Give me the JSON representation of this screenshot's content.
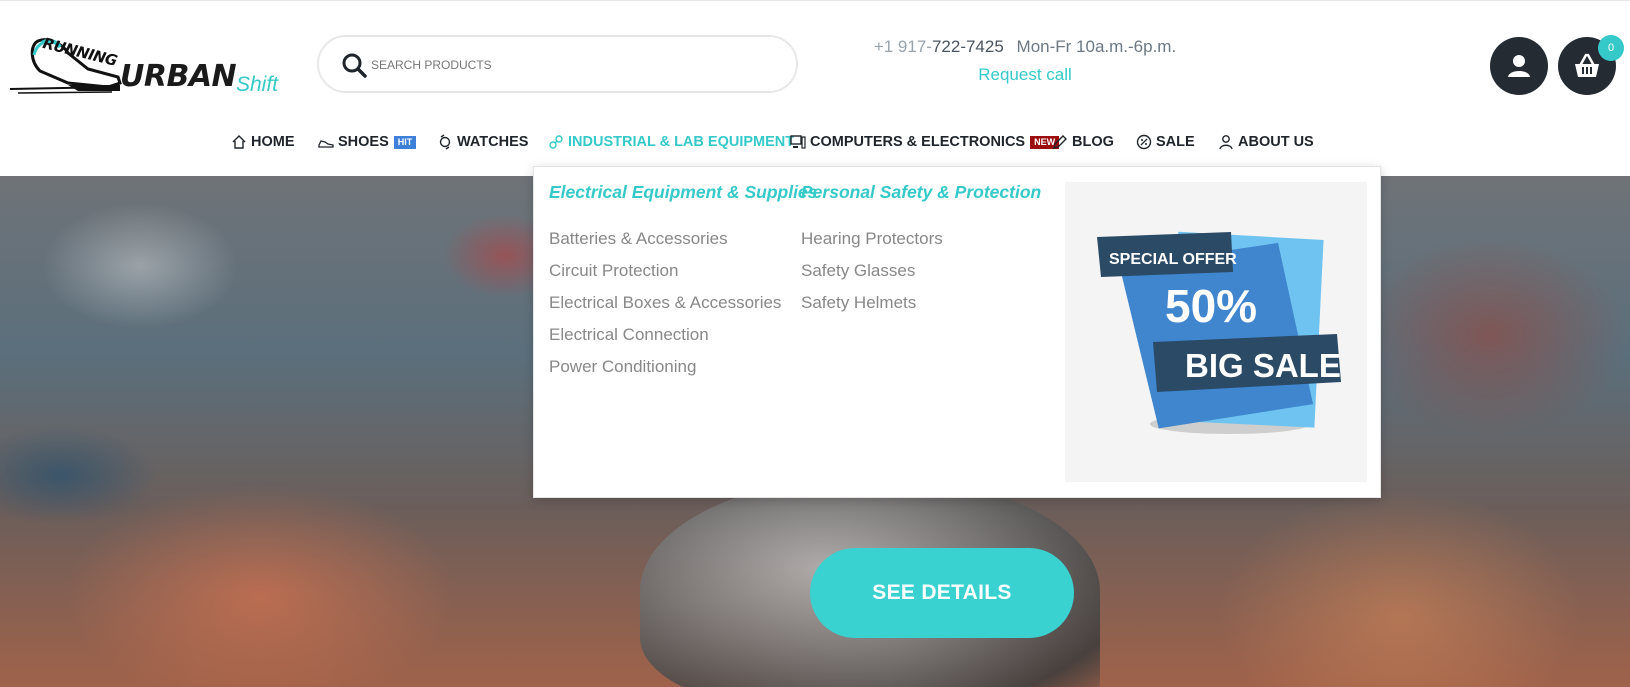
{
  "brand": {
    "running": "RUNNING",
    "urban": "URBAN",
    "shift": "Shift"
  },
  "search": {
    "placeholder": "SEARCH PRODUCTS"
  },
  "contact": {
    "phone_prefix": "+1 917-",
    "phone_main": "722-7425",
    "hours": "Mon-Fr 10a.m.-6p.m.",
    "request_call": "Request call"
  },
  "cart": {
    "count": "0"
  },
  "nav": {
    "items": [
      {
        "label": "HOME",
        "icon": "home-icon"
      },
      {
        "label": "SHOES",
        "icon": "shoe-icon",
        "badge": "HIT"
      },
      {
        "label": "WATCHES",
        "icon": "watch-icon"
      },
      {
        "label": "INDUSTRIAL & LAB EQUIPMENT",
        "icon": "link-icon",
        "active": true
      },
      {
        "label": "COMPUTERS & ELECTRONICS",
        "icon": "computer-icon",
        "badge": "NEW"
      },
      {
        "label": "BLOG",
        "icon": "pencil-icon"
      },
      {
        "label": "SALE",
        "icon": "discount-icon"
      },
      {
        "label": "ABOUT US",
        "icon": "user-icon"
      }
    ]
  },
  "mega_menu": {
    "columns": [
      {
        "heading": "Electrical Equipment & Supplies",
        "links": [
          "Batteries & Accessories",
          "Circuit Protection",
          "Electrical Boxes & Accessories",
          "Electrical Connection",
          "Power Conditioning"
        ]
      },
      {
        "heading": "Personal Safety & Protection",
        "links": [
          "Hearing Protectors",
          "Safety Glasses",
          "Safety Helmets"
        ]
      }
    ],
    "promo": {
      "line1": "SPECIAL OFFER",
      "line2": "50%",
      "line3": "BIG SALE"
    }
  },
  "hero": {
    "button": "SEE DETAILS"
  },
  "colors": {
    "accent": "#35c9c9",
    "dark": "#252b33",
    "badge_hit": "#3d7fd9",
    "badge_new": "#9c0d0d"
  }
}
